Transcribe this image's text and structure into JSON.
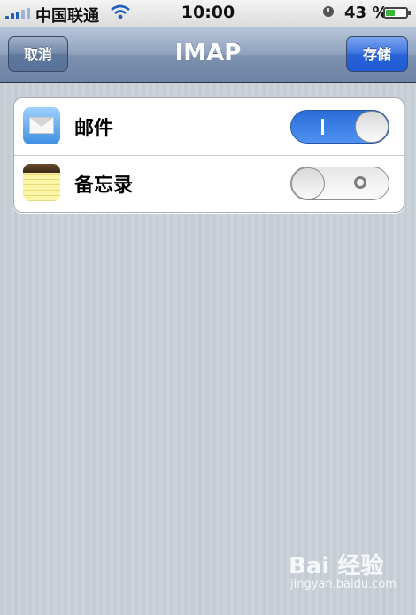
{
  "status_bar": {
    "carrier": "中国联通",
    "time": "10:00",
    "battery_percent": "43 %",
    "battery_level": 0.43
  },
  "nav_bar": {
    "title": "IMAP",
    "left_button": "取消",
    "right_button": "存储"
  },
  "settings": {
    "items": [
      {
        "label": "邮件",
        "icon": "mail-icon",
        "enabled": true
      },
      {
        "label": "备忘录",
        "icon": "notes-icon",
        "enabled": false
      }
    ]
  },
  "watermark": {
    "brand": "Bai 经验",
    "url": "jingyan.baidu.com"
  },
  "colors": {
    "nav_bar": "#7d91af",
    "save_button": "#2a62d6",
    "switch_on": "#3b7ee6",
    "background": "#c5ccd4"
  }
}
